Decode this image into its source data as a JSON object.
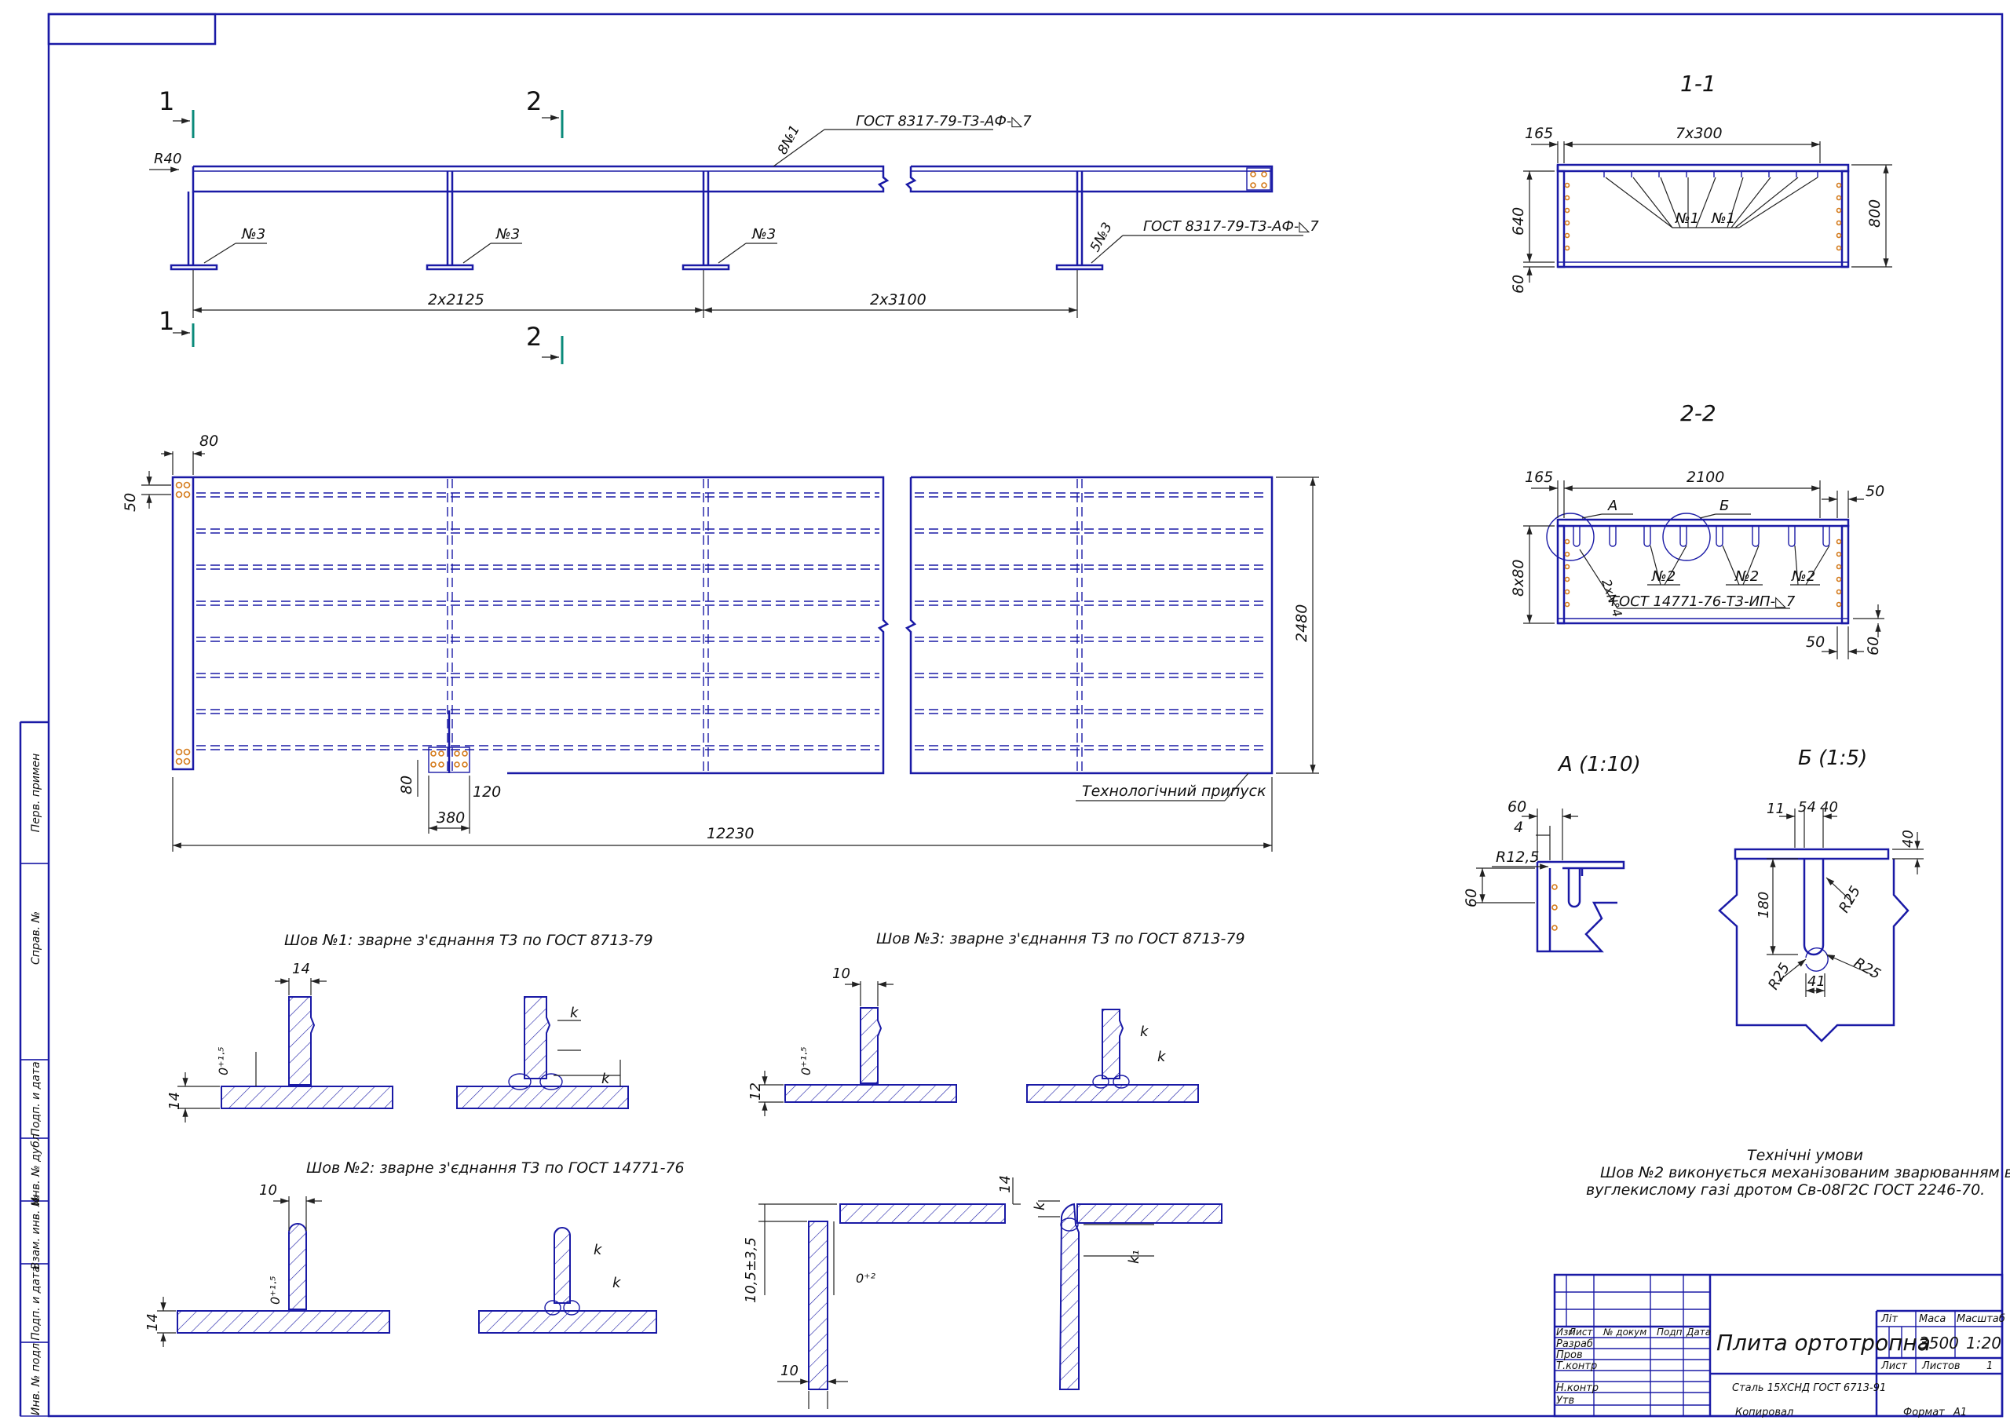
{
  "sections": {
    "s1": "1-1",
    "s2": "2-2",
    "detailA": "А (1:10)",
    "detailB": "Б (1:5)",
    "cut1": "1",
    "cut2": "2"
  },
  "elevation": {
    "r40": "R40",
    "weld_top": "ГОСТ 8317-79-Т3-АФ-◺7",
    "weld_right": "ГОСТ 8317-79-Т3-АФ-◺7",
    "n1_label": "8№1",
    "n3": "№3",
    "n3_5": "5№3",
    "dim_left": "2x2125",
    "dim_right": "2x3100"
  },
  "plan": {
    "d80": "80",
    "d50": "50",
    "d2480": "2480",
    "d12230": "12230",
    "d380": "380",
    "d80b": "80",
    "d120": "120",
    "allowance": "Технологічний припуск"
  },
  "sec11": {
    "d165": "165",
    "d7x300": "7x300",
    "d640": "640",
    "d60": "60",
    "d800": "800",
    "n1a": "№1",
    "n1b": "№1"
  },
  "sec22": {
    "d165": "165",
    "d2100": "2100",
    "d50a": "50",
    "d50b": "50",
    "d60": "60",
    "d8x80": "8x80",
    "a": "А",
    "b": "Б",
    "n2": "2хN°4",
    "n2a": "№2",
    "n2b": "№2",
    "n2c": "№2",
    "weld": "ГОСТ 14771-76-Т3-ИП-◺7"
  },
  "detA": {
    "d60": "60",
    "d4": "4",
    "r125": "R12,5",
    "d60v": "60"
  },
  "detB": {
    "d11": "11",
    "d54": "54",
    "d40": "40",
    "d40v": "40",
    "d180": "180",
    "r25a": "R25",
    "r25b": "R25",
    "r25c": "R25",
    "d41": "41"
  },
  "welds": {
    "w1_title": "Шов №1: зварне з'єднання Т3 по ГОСТ 8713-79",
    "w3_title": "Шов №3: зварне з'єднання Т3 по ГОСТ 8713-79",
    "w2_title": "Шов №2: зварне з'єднання Т3 по ГОСТ 14771-76",
    "d14": "14",
    "d14b": "14",
    "d10": "10",
    "d10b": "10",
    "d12": "12",
    "d14c": "14",
    "gap": "0⁺¹·⁵",
    "gap2": "0⁺²",
    "k": "k",
    "k1": "k₁",
    "d105": "10,5±3,5",
    "d14t": "14",
    "d10l": "10"
  },
  "notes": {
    "title": "Технічні умови",
    "line1": "Шов №2 виконується механізованим зварюванням в",
    "line2": "вуглекислому газі дротом Св-08Г2С ГОСТ 2246-70."
  },
  "titleblock": {
    "name": "Плита ортотропна",
    "material": "Сталь 15ХСНД ГОСТ 6713-91",
    "lit": "Літ",
    "mass_h": "Маса",
    "scale_h": "Масштаб",
    "mass": "3500",
    "scale": "1:20",
    "sheet": "Лист",
    "sheets": "Листов",
    "sheets_n": "1",
    "rows": [
      "Изм",
      "Лист",
      "№ докум",
      "Подп",
      "Дата"
    ],
    "roles": [
      "Разраб",
      "Пров",
      "Т.контр",
      "Н.контр",
      "Утв"
    ],
    "copied": "Копировал",
    "format": "Формат",
    "format_v": "А1"
  },
  "sidebar": [
    "Перв. примен",
    "Справ. №",
    "Подп. и дата",
    "Инв. № дубл",
    "Взам. инв. №",
    "Подп. и дата",
    "Инв. № подл"
  ]
}
